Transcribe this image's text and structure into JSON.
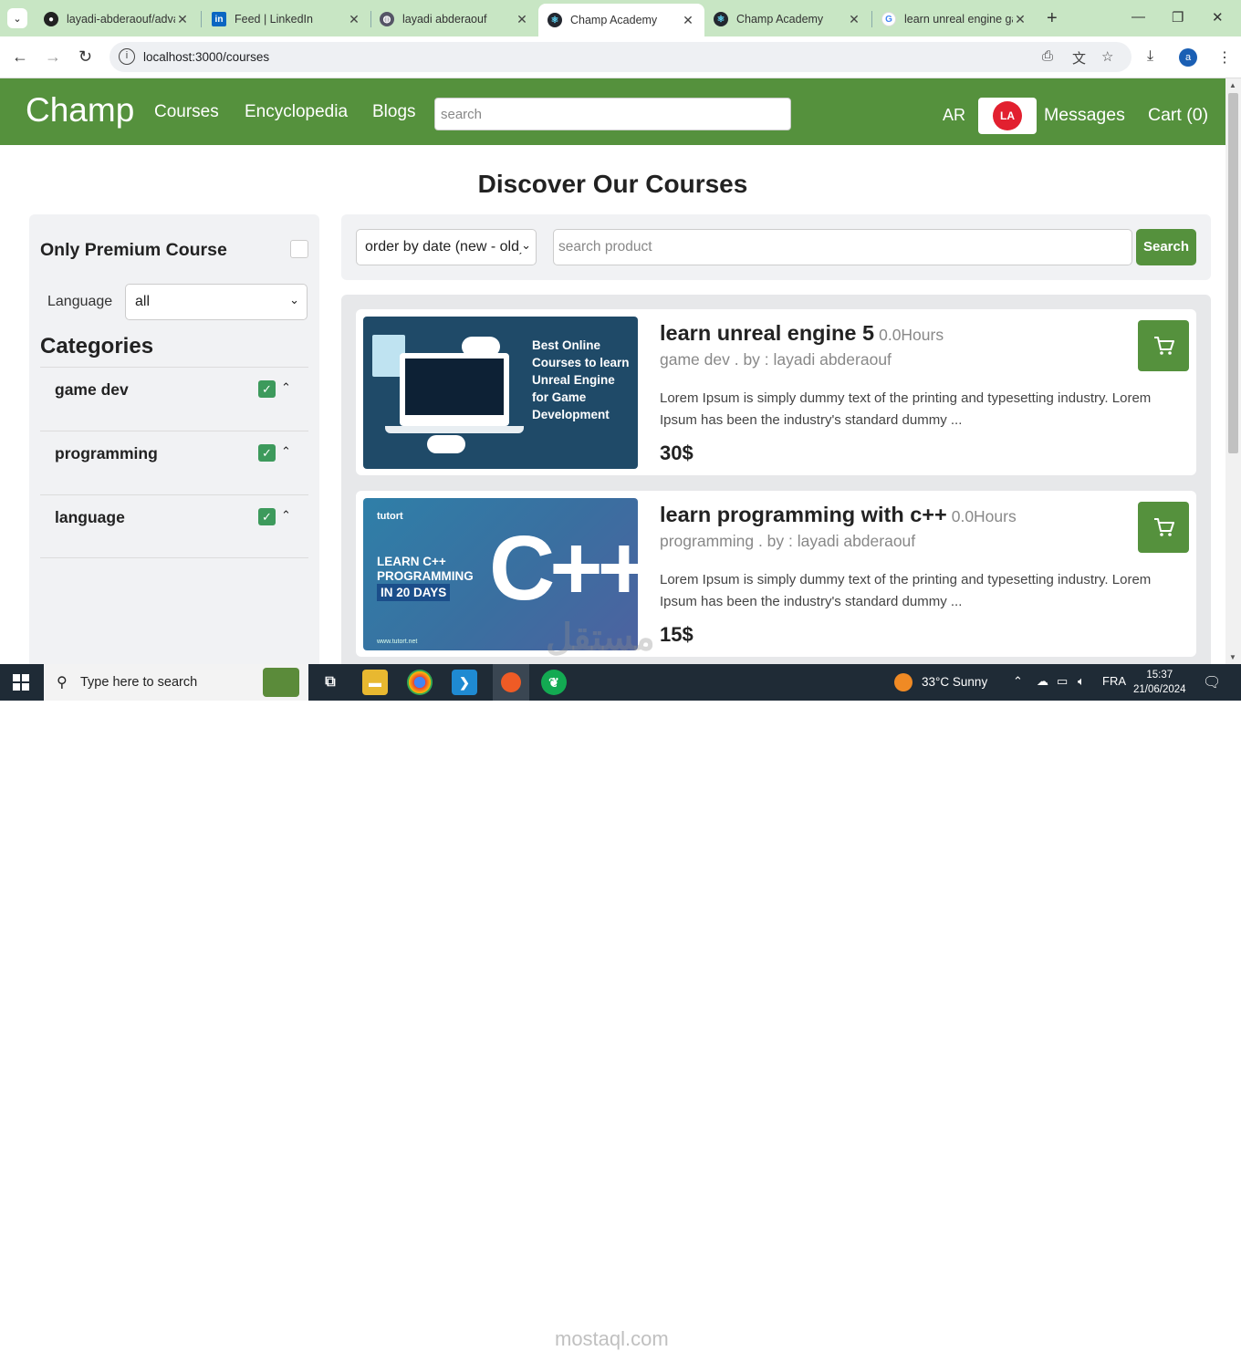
{
  "browser": {
    "tabs": [
      {
        "title": "layadi-abderaouf/advanced",
        "icon": "github-icon"
      },
      {
        "title": "Feed | LinkedIn",
        "icon": "linkedin-icon"
      },
      {
        "title": "layadi abderaouf",
        "icon": "globe-icon"
      },
      {
        "title": "Champ Academy",
        "icon": "react-icon",
        "active": true
      },
      {
        "title": "Champ Academy",
        "icon": "react-icon"
      },
      {
        "title": "learn unreal engine game",
        "icon": "google-icon"
      }
    ],
    "url": "localhost:3000/courses",
    "profile_initial": "a"
  },
  "site": {
    "brand": "Champ",
    "nav": {
      "courses": "Courses",
      "encyclopedia": "Encyclopedia",
      "blogs": "Blogs"
    },
    "search_placeholder": "search",
    "lang": "AR",
    "avatar_initials": "LA",
    "messages": "Messages",
    "cart": "Cart (0)"
  },
  "page": {
    "title": "Discover Our Courses"
  },
  "sidebar": {
    "premium_label": "Only Premium Course",
    "premium_checked": false,
    "language_label": "Language",
    "language_value": "all",
    "categories_title": "Categories",
    "categories": [
      {
        "name": "game dev",
        "checked": true
      },
      {
        "name": "programming",
        "checked": true
      },
      {
        "name": "language",
        "checked": true
      }
    ]
  },
  "filters": {
    "order_value": "order by date (new - old)",
    "search_placeholder": "search product",
    "search_button": "Search"
  },
  "courses": [
    {
      "title": "learn unreal engine 5",
      "hours": "0.0Hours",
      "meta": "game dev . by : layadi abderaouf",
      "description": "Lorem Ipsum is simply dummy text of the printing and typesetting industry. Lorem Ipsum has been the industry's standard dummy ...",
      "price": "30$",
      "thumb_text": "Best Online Courses to learn Unreal Engine for Game Development"
    },
    {
      "title": "learn programming with c++",
      "hours": "0.0Hours",
      "meta": "programming . by : layadi abderaouf",
      "description": "Lorem Ipsum is simply dummy text of the printing and typesetting industry. Lorem Ipsum has been the industry's standard dummy ...",
      "price": "15$",
      "thumb_brand": "tutort",
      "thumb_text": "LEARN C++ PROGRAMMING",
      "thumb_days": "IN 20 DAYS",
      "thumb_logo": "C++",
      "thumb_footer": "www.tutort.net"
    }
  ],
  "watermark": {
    "arabic": "مستقل",
    "latin": "mostaql.com"
  },
  "taskbar": {
    "search_placeholder": "Type here to search",
    "weather": "33°C  Sunny",
    "lang": "FRA",
    "time": "15:37",
    "date": "21/06/2024"
  },
  "colors": {
    "brand_green": "#55913d",
    "checkbox_green": "#3d9a5c",
    "avatar_red": "#e2202f"
  }
}
